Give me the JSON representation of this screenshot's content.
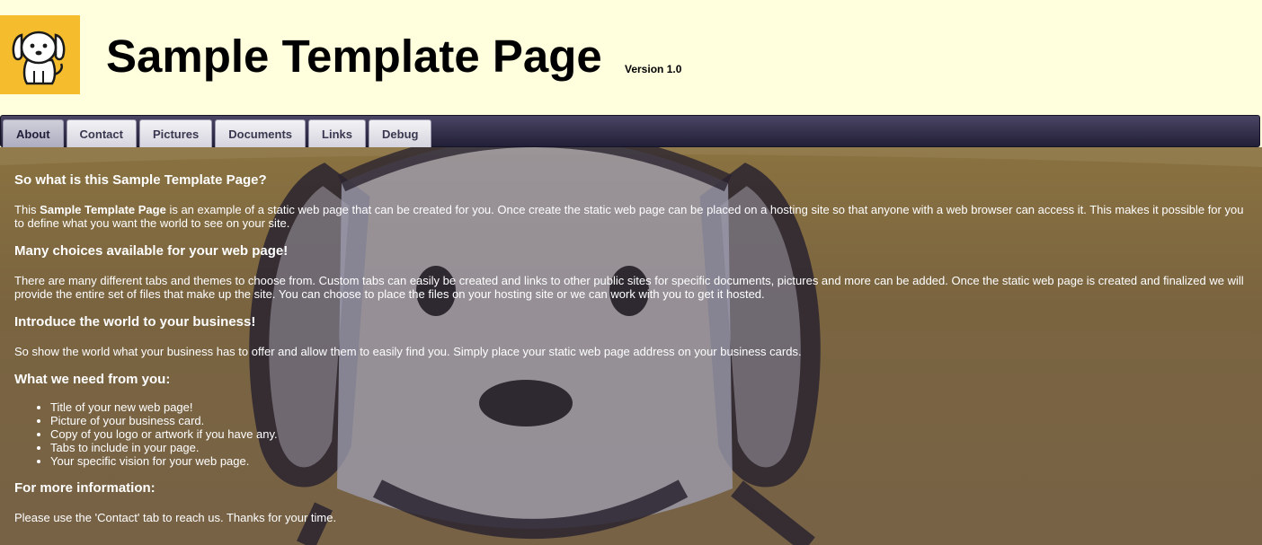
{
  "header": {
    "title": "Sample Template Page",
    "version": "Version 1.0",
    "logo_icon": "dog-icon"
  },
  "tabs": [
    {
      "label": "About",
      "active": true
    },
    {
      "label": "Contact",
      "active": false
    },
    {
      "label": "Pictures",
      "active": false
    },
    {
      "label": "Documents",
      "active": false
    },
    {
      "label": "Links",
      "active": false
    },
    {
      "label": "Debug",
      "active": false
    }
  ],
  "content": {
    "s1_heading": "So what is this Sample Template Page?",
    "s1_pre": "This ",
    "s1_bold": "Sample Template Page",
    "s1_post": " is an example of a static web page that can be created for you. Once create the static web page can be placed on a hosting site so that anyone with a web browser can access it. This makes it possible for you to define what you want the world to see on your site.",
    "s2_heading": "Many choices available for your web page!",
    "s2_text": "There are many different tabs and themes to choose from. Custom tabs can easily be created and links to other public sites for specific documents, pictures and more can be added. Once the static web page is created and finalized we will provide the entire set of files that make up the site. You can choose to place the files on your hosting site or we can work with you to get it hosted.",
    "s3_heading": "Introduce the world to your business!",
    "s3_text": "So show the world what your business has to offer and allow them to easily find you. Simply place your static web page address on your business cards.",
    "s4_heading": "What we need from you:",
    "s4_items": [
      "Title of your new web page!",
      "Picture of your business card.",
      "Copy of you logo or artwork if you have any.",
      "Tabs to include in your page.",
      "Your specific vision for your web page."
    ],
    "s5_heading": "For more information:",
    "s5_text": "Please use the 'Contact' tab to reach us. Thanks for your time."
  },
  "colors": {
    "header_bg": "#fffedd",
    "logo_bg": "#f5bd2e",
    "tabbar_bg": "#2e2a47",
    "content_bg": "#7a6440"
  }
}
